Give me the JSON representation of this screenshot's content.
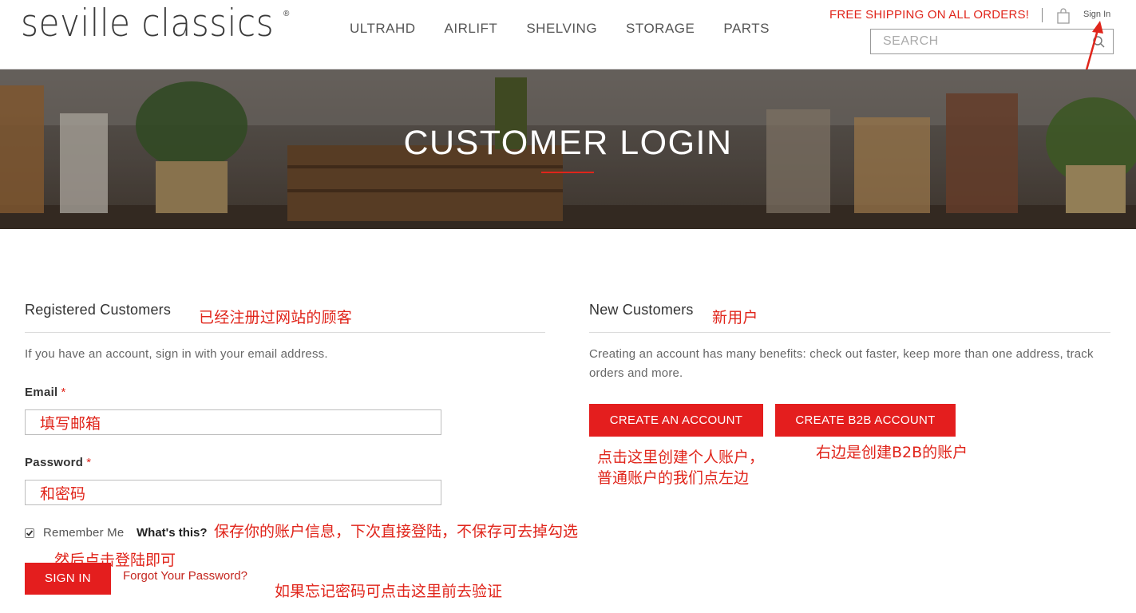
{
  "header": {
    "logo_text": "seville classics",
    "logo_reg": "®",
    "nav": [
      "ULTRAHD",
      "AIRLIFT",
      "SHELVING",
      "STORAGE",
      "PARTS"
    ],
    "shipping_text": "FREE SHIPPING ON ALL ORDERS!",
    "sign_in": "Sign In",
    "search_placeholder": "SEARCH"
  },
  "banner": {
    "title": "CUSTOMER LOGIN"
  },
  "registered": {
    "title": "Registered Customers",
    "annotation": "已经注册过网站的顾客",
    "intro": "If you have an account, sign in with your email address.",
    "email_label": "Email",
    "email_value": "填写邮箱",
    "password_label": "Password",
    "password_value": "和密码",
    "required_mark": "*",
    "remember_label": "Remember Me",
    "whats_this": "What's this?",
    "remember_annotation": "保存你的账户信息，下次直接登陆，不保存可去掉勾选",
    "signin_annotation": "然后点击登陆即可",
    "signin_button": "SIGN IN",
    "forgot_link": "Forgot Your Password?",
    "forgot_annotation": "如果忘记密码可点击这里前去验证",
    "remember_checked": true
  },
  "new_customers": {
    "title": "New Customers",
    "annotation": "新用户",
    "intro": "Creating an account has many benefits: check out faster, keep more than one address, track orders and more.",
    "create_button": "CREATE AN ACCOUNT",
    "create_b2b_button": "CREATE B2B ACCOUNT",
    "create_annotation_line1": "点击这里创建个人账户，",
    "create_annotation_line2": "普通账户的我们点左边",
    "b2b_annotation": "右边是创建B2B的账户"
  },
  "colors": {
    "accent_red": "#e41e1e",
    "annotation_red": "#e0251b",
    "text_dark": "#333333"
  },
  "icons": [
    "shopping-bag-icon",
    "search-icon",
    "checkmark-icon",
    "annotation-arrow-icon"
  ]
}
